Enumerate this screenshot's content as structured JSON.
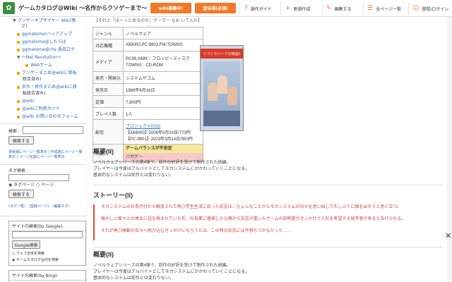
{
  "header": {
    "logo_glyph": "✿",
    "title": "ゲームカタログ@Wiki ～名作からクソゲーまで～",
    "wiki_btn": "wiki募集中!",
    "ad_btn": "宣伝場(必須)",
    "nav": [
      {
        "icon": "?",
        "label": "操作ガイド"
      },
      {
        "icon": "+",
        "label": "新規作成"
      },
      {
        "icon": "✎",
        "label": "編集する"
      },
      {
        "icon": "☰",
        "label": "全ページ一覧"
      },
      {
        "icon": "☺",
        "label": "登録/ログイン"
      }
    ]
  },
  "sidebar": {
    "links": [
      "クソゲーオブザイヤー Wiki(携",
      "グ)",
      "ggmatome(バックアップ",
      "ggmatome@したらば",
      "ggmatome@chs 過去ログ",
      "～Net Revolution～",
      "Webゲーム",
      "クソゲーまとめ@wikiに移転",
      "統合済み)",
      "名作・良作まとめ@wikiに移",
      "転統合済み)",
      "@wiki",
      "@wikiご利用ガイド",
      "@wiki お問い合わせフォーム"
    ],
    "search_label": "検索 :",
    "search_btn": "検索する",
    "recent_links": "更新順にページ一覧表示 | 作成順にページ一覧表示 | ページ名順にページ一覧表示",
    "tag_label": "タグ検索 :",
    "radio_tag": "タグページ",
    "radio_page": "ページ",
    "tag_btn": "検索する",
    "tag_links": "(タグ一覧)　(登録ページ)　(編集タグ)",
    "google_title": "サイト内検索(by Google):",
    "google_btn": "Google検索",
    "web_search": "ウェブ全体を検索",
    "site_search": "ゲームカタログ@内を検索",
    "bing_title": "サイト内検索(by Bing):"
  },
  "main": {
    "top_note": "【それと「ぼーっとあるのだ」ゲーマー なお いてんだ】",
    "rows": [
      {
        "k": "ジャンル",
        "v": "ノベルウェア"
      },
      {
        "k": "対応機種",
        "v": "X68000,PC-9801,FM-TOWNS"
      },
      {
        "k": "メディア",
        "v": "PC98,X68K：フロッピーディスク",
        "v2": "TOWNS：CD-ROM"
      },
      {
        "k": "発売・開発元",
        "v": "システムサコム"
      },
      {
        "k": "発売日",
        "v": "1989年6月16日"
      },
      {
        "k": "定価",
        "v": "7,800円"
      },
      {
        "k": "プレイ人数",
        "v": "1人"
      },
      {
        "k": "配信",
        "v": "プロジェクトEGG",
        "v2": "【X68000】2008年5月24日/770円",
        "v3": "【PC-9801】2023年3月14日/550円"
      },
      {
        "k": "判定",
        "v": "ゲームバランスが不安定",
        "v2": "バカゲー"
      }
    ],
    "cover_title": "ソフトでハードな物語2",
    "overview_heading": "概要(II)",
    "overview_lines": [
      "ノベルウェアシリーズの第4弾で、前作の好評を受けて制作された続編。",
      "プレイヤーは今度はアルバイトとしてモカシステムにかかわっていくことになる。",
      "基本的なシステムは前作とは変わりない。"
    ],
    "story_heading": "ストーリー(II)",
    "story_lines": [
      "モカシステムの社長代行から解放されて再び学生生活に戻った宏志は、ひょんなことからモカシステムの日々を思い出して久しぶりに顔を出そうと思い立つ。",
      "懐かしい面々との再会に話を弾ませていた折、社長業に復帰した父親から宏志が書いたゲームの説明書がきっかけで入社を希望する就学者が来ると告げられる。",
      "それが再び激動の日々へ飛び込むきっかけになろうとは、この時の宏志には予想もつかなかった……"
    ],
    "overview2_heading": "概要(II)",
    "overview2_lines": [
      "ノベルウェアシリーズの第4弾で、前作の好評を受けて制作された続編。",
      "プレイヤーは今度はアルバイトとしてモカシステムにかかわっていくことになる。",
      "基本的なシステムは前作とは変わりない。"
    ],
    "close_glyph": "✕"
  }
}
